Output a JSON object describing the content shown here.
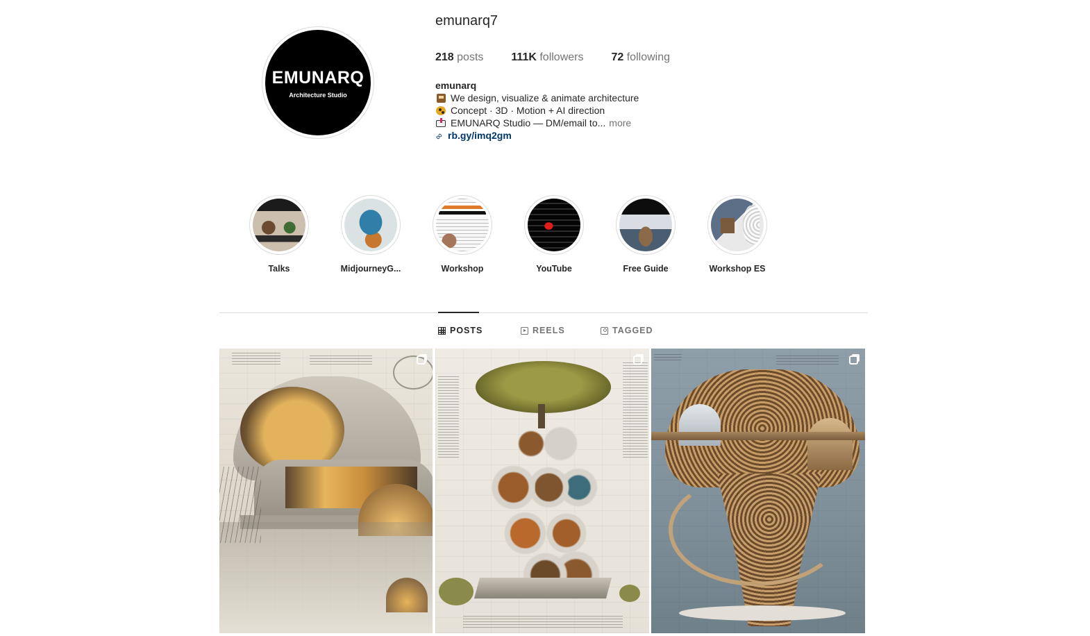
{
  "profile": {
    "username": "emunarq7",
    "avatar": {
      "brand": "EMUNARQ",
      "subtitle": "Architecture Studio"
    },
    "stats": [
      {
        "value": "218",
        "label": "posts"
      },
      {
        "value": "111K",
        "label": "followers"
      },
      {
        "value": "72",
        "label": "following"
      }
    ],
    "bio": {
      "name": "emunarq",
      "lines": [
        {
          "icon": "building-construction-icon",
          "text": "We design, visualize & animate architecture"
        },
        {
          "icon": "artist-palette-icon",
          "text": "Concept · 3D · Motion + AI direction"
        },
        {
          "icon": "inbox-tray-icon",
          "text": "EMUNARQ Studio — DM/email to..."
        }
      ],
      "more_label": "more",
      "link": "rb.gy/imq2gm"
    }
  },
  "highlights": [
    {
      "label": "Talks"
    },
    {
      "label": "MidjourneyG..."
    },
    {
      "label": "Workshop"
    },
    {
      "label": "YouTube"
    },
    {
      "label": "Free Guide"
    },
    {
      "label": "Workshop ES"
    }
  ],
  "tabs": [
    {
      "label": "POSTS",
      "icon": "grid-icon",
      "active": true
    },
    {
      "label": "REELS",
      "icon": "reels-icon",
      "active": false
    },
    {
      "label": "TAGGED",
      "icon": "tagged-icon",
      "active": false
    }
  ],
  "posts": [
    {
      "icon": "carousel-icon"
    },
    {
      "icon": "carousel-icon"
    },
    {
      "icon": "carousel-icon"
    }
  ]
}
